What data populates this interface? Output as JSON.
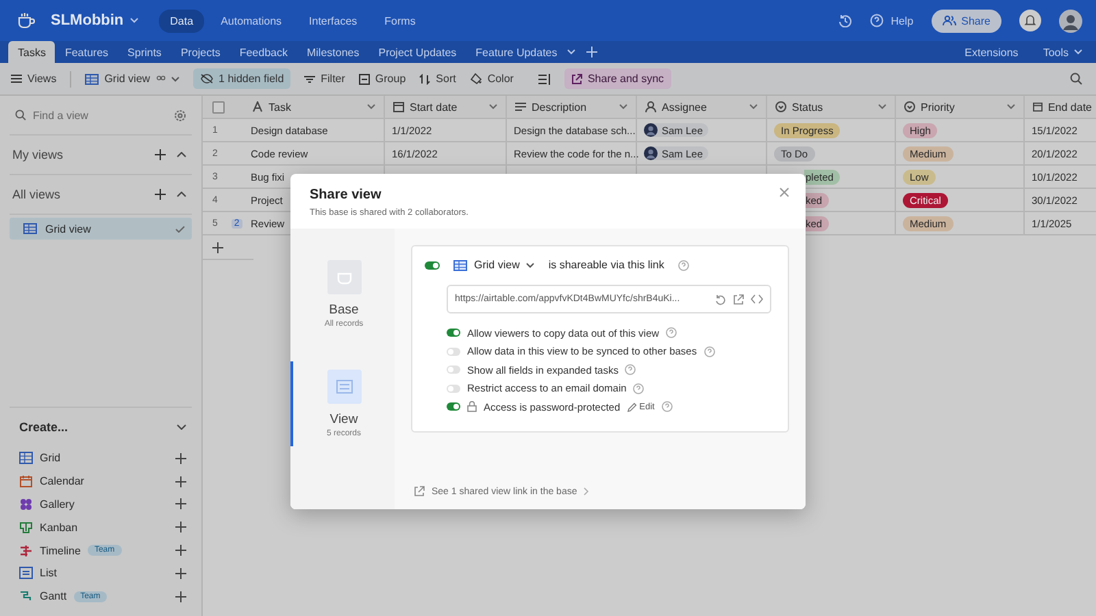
{
  "app": {
    "base_name": "SLMobbin",
    "nav": [
      {
        "label": "Data",
        "selected": true
      },
      {
        "label": "Automations",
        "selected": false
      },
      {
        "label": "Interfaces",
        "selected": false
      },
      {
        "label": "Forms",
        "selected": false
      }
    ],
    "help": "Help",
    "share": "Share"
  },
  "table_tabs": [
    {
      "label": "Tasks",
      "selected": true
    },
    {
      "label": "Features",
      "selected": false
    },
    {
      "label": "Sprints",
      "selected": false
    },
    {
      "label": "Projects",
      "selected": false
    },
    {
      "label": "Feedback",
      "selected": false
    },
    {
      "label": "Milestones",
      "selected": false
    },
    {
      "label": "Project Updates",
      "selected": false
    },
    {
      "label": "Feature Updates",
      "selected": false
    }
  ],
  "extensions": "Extensions",
  "tools": "Tools",
  "toolbar": {
    "views": "Views",
    "view_name": "Grid view",
    "hidden_fields": "1 hidden field",
    "filter": "Filter",
    "group": "Group",
    "sort": "Sort",
    "color_label": "Color",
    "share_sync": "Share and sync"
  },
  "sidebar": {
    "search_placeholder": "Find a view",
    "sections": [
      {
        "title": "My views"
      },
      {
        "title": "All views",
        "items": [
          {
            "label": "Grid view",
            "selected": true
          }
        ]
      }
    ],
    "create_title": "Create...",
    "create_items": [
      {
        "label": "Grid",
        "kind": "grid"
      },
      {
        "label": "Calendar",
        "kind": "calendar"
      },
      {
        "label": "Gallery",
        "kind": "gallery"
      },
      {
        "label": "Kanban",
        "kind": "kanban"
      },
      {
        "label": "Timeline",
        "kind": "timeline",
        "badge": "Team"
      },
      {
        "label": "List",
        "kind": "list"
      },
      {
        "label": "Gantt",
        "kind": "gantt",
        "badge": "Team"
      }
    ]
  },
  "table": {
    "select_all_checked": false,
    "columns": [
      {
        "label": "Task",
        "kind": "text"
      },
      {
        "label": "Start date",
        "kind": "date"
      },
      {
        "label": "Description",
        "kind": "longtext"
      },
      {
        "label": "Assignee",
        "kind": "user"
      },
      {
        "label": "Status",
        "kind": "select"
      },
      {
        "label": "Priority",
        "kind": "select"
      },
      {
        "label": "End date",
        "kind": "date"
      }
    ],
    "rows": [
      {
        "number": "1",
        "task": "Design database",
        "start": "1/1/2022",
        "description": "Design the database sch...",
        "assignee": "Sam Lee",
        "status": {
          "text": "In Progress",
          "color": "#cab680",
          "cut_left": false
        },
        "priority": {
          "text": "High",
          "color": "#c9a6b0",
          "white_text": false
        },
        "end": "15/1/2022"
      },
      {
        "number": "2",
        "task": "Code review",
        "start": "16/1/2022",
        "description": "Review the code for the n...",
        "assignee": "Sam Lee",
        "status": {
          "text": "To Do",
          "color": "#b5b6ba",
          "cut_left": false
        },
        "priority": {
          "text": "Medium",
          "color": "#cab39d",
          "white_text": false
        },
        "end": "20/1/2022"
      },
      {
        "number": "3",
        "task": "Bug fixi",
        "status": {
          "text": "pleted",
          "color": "#a1bfa6",
          "cut_left": true
        },
        "priority": {
          "text": "Low",
          "color": "#cabb8d",
          "white_text": false
        },
        "end": "10/1/2022"
      },
      {
        "number": "4",
        "task": "Project",
        "status": {
          "text": "ked",
          "color": "#c9a6b0",
          "cut_left": true
        },
        "priority": {
          "text": "Critical",
          "color": "#ad1635",
          "white_text": true
        },
        "end": "30/1/2022"
      },
      {
        "number": "5",
        "comments": "2",
        "task": "Review",
        "status": {
          "text": "ked",
          "color": "#c9a6b0",
          "cut_left": true
        },
        "priority": {
          "text": "Medium",
          "color": "#cab39d",
          "white_text": false
        },
        "end": "1/1/2025"
      }
    ]
  },
  "modal": {
    "title": "Share view",
    "subtitle": "This base is shared with 2 collaborators.",
    "targets": [
      {
        "label": "Base",
        "sub": "All records",
        "kind": "base",
        "selected": false
      },
      {
        "label": "View",
        "sub": "5 records",
        "kind": "view",
        "selected": true
      }
    ],
    "link_enabled": true,
    "view_name": "Grid view",
    "shareable_text": "is shareable via this link",
    "url": "https://airtable.com/appvfvKDt4BwMUYfc/shrB4uKi...",
    "options": [
      {
        "label": "Allow viewers to copy data out of this view",
        "on": true
      },
      {
        "label": "Allow data in this view to be synced to other bases",
        "on": false
      },
      {
        "label": "Show all fields in expanded tasks",
        "on": false
      },
      {
        "label": "Restrict access to an email domain",
        "on": false
      },
      {
        "label": "Access is password-protected",
        "on": true,
        "kind": "password",
        "edit": "Edit"
      }
    ],
    "footer_link": "See 1 shared view link in the base"
  }
}
